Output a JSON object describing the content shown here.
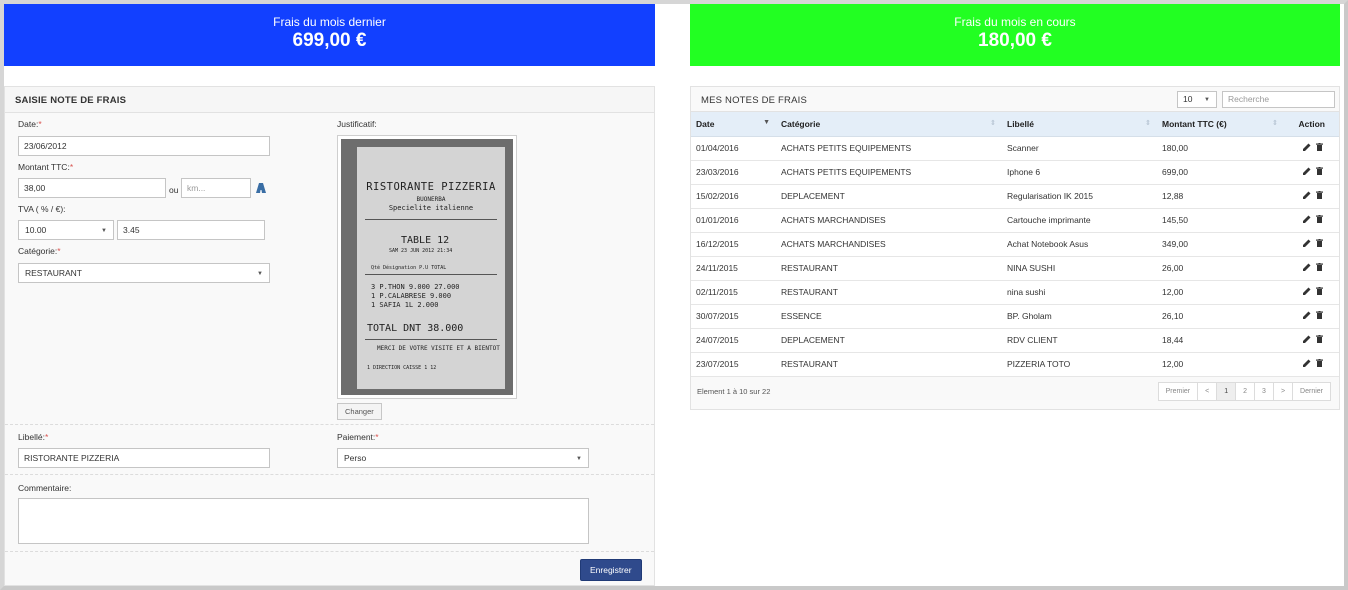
{
  "stats": {
    "last_month_label": "Frais du mois dernier",
    "last_month_value": "699,00 €",
    "current_month_label": "Frais du mois en cours",
    "current_month_value": "180,00 €",
    "last_color": "#1240ff",
    "current_color": "#22ff22"
  },
  "form": {
    "title": "SAISIE NOTE DE FRAIS",
    "date_label": "Date:",
    "date_value": "23/06/2012",
    "amount_label": "Montant TTC:",
    "amount_value": "38,00",
    "or_label": "ou",
    "km_placeholder": "km...",
    "tva_label": "TVA ( % / €):",
    "tva_rate": "10.00",
    "tva_amount": "3.45",
    "category_label": "Catégorie:",
    "category_value": "RESTAURANT",
    "receipt_label": "Justificatif:",
    "change_button": "Changer",
    "libelle_label": "Libellé:",
    "libelle_value": "RISTORANTE PIZZERIA",
    "payment_label": "Paiement:",
    "payment_value": "Perso",
    "comment_label": "Commentaire:",
    "comment_value": "",
    "save_button": "Enregistrer",
    "required_mark": "*"
  },
  "receipt": {
    "name": "RISTORANTE PIZZERIA",
    "line2": "BUONERBA",
    "line3": "Specielite italienne",
    "table": "TABLE  12",
    "date": "SAM 23 JUN 2012  21:34",
    "header": "Qté Désignation       P.U  TOTAL",
    "items": [
      "3 P.THON       9.000  27.000",
      "1 P.CALABRESE          9.000",
      "1 SAFIA 1L             2.000"
    ],
    "total": "TOTAL DNT    38.000",
    "thanks": "MERCI DE VOTRE VISITE ET A BIENTOT",
    "footer": "1 DIRECTION     CAISSE   1    12"
  },
  "list": {
    "title": "MES NOTES DE FRAIS",
    "page_size": "10",
    "search_placeholder": "Recherche",
    "columns": [
      "Date",
      "Catégorie",
      "Libellé",
      "Montant TTC (€)",
      "Action"
    ],
    "rows": [
      {
        "date": "01/04/2016",
        "category": "ACHATS PETITS EQUIPEMENTS",
        "label": "Scanner",
        "amount": "180,00"
      },
      {
        "date": "23/03/2016",
        "category": "ACHATS PETITS EQUIPEMENTS",
        "label": "Iphone 6",
        "amount": "699,00"
      },
      {
        "date": "15/02/2016",
        "category": "DEPLACEMENT",
        "label": "Regularisation IK 2015",
        "amount": "12,88"
      },
      {
        "date": "01/01/2016",
        "category": "ACHATS MARCHANDISES",
        "label": "Cartouche imprimante",
        "amount": "145,50"
      },
      {
        "date": "16/12/2015",
        "category": "ACHATS MARCHANDISES",
        "label": "Achat Notebook Asus",
        "amount": "349,00"
      },
      {
        "date": "24/11/2015",
        "category": "RESTAURANT",
        "label": "NINA SUSHI",
        "amount": "26,00"
      },
      {
        "date": "02/11/2015",
        "category": "RESTAURANT",
        "label": "nina sushi",
        "amount": "12,00"
      },
      {
        "date": "30/07/2015",
        "category": "ESSENCE",
        "label": "BP. Gholam",
        "amount": "26,10"
      },
      {
        "date": "24/07/2015",
        "category": "DEPLACEMENT",
        "label": "RDV CLIENT",
        "amount": "18,44"
      },
      {
        "date": "23/07/2015",
        "category": "RESTAURANT",
        "label": "PIZZERIA TOTO",
        "amount": "12,00"
      }
    ],
    "info": "Element 1 à 10 sur 22",
    "pagination": [
      "Premier",
      "<",
      "1",
      "2",
      "3",
      ">",
      "Dernier"
    ],
    "active_page": "1"
  }
}
